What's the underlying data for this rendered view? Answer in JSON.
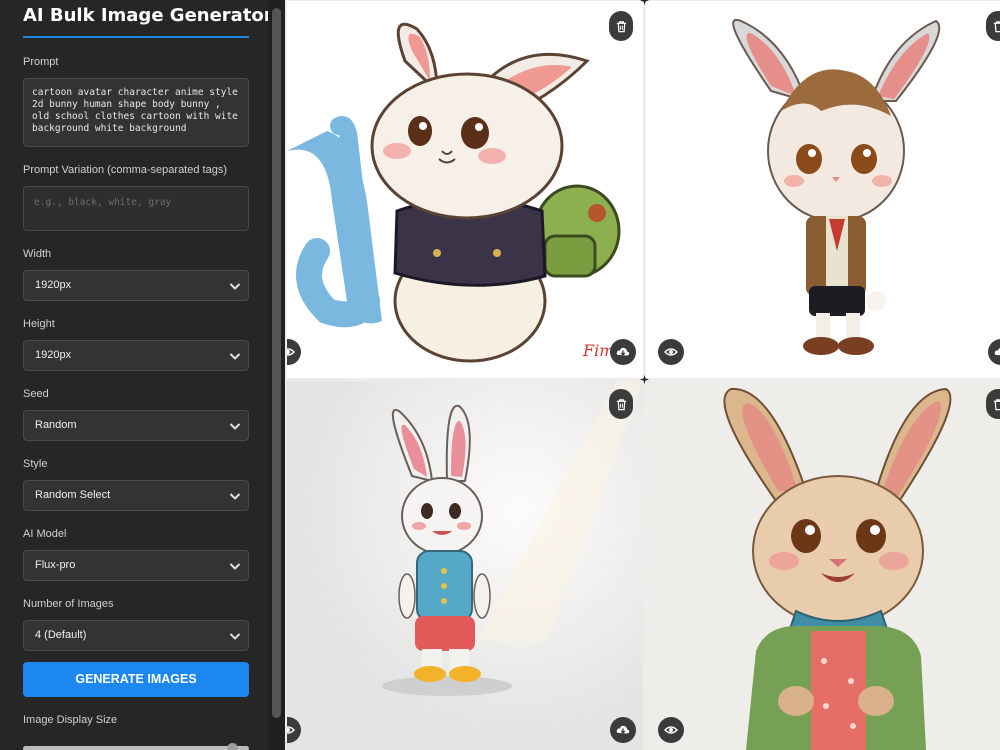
{
  "app": {
    "title": "AI Bulk Image Generator"
  },
  "form": {
    "prompt_label": "Prompt",
    "prompt_value": "cartoon avatar character anime style 2d bunny human shape body bunny , old school clothes cartoon with wite background white background",
    "variation_label": "Prompt Variation (comma-separated tags)",
    "variation_placeholder": "e.g., black, white, gray",
    "width_label": "Width",
    "width_value": "1920px",
    "height_label": "Height",
    "height_value": "1920px",
    "seed_label": "Seed",
    "seed_value": "Random",
    "style_label": "Style",
    "style_value": "Random Select",
    "model_label": "AI Model",
    "model_value": "Flux-pro",
    "count_label": "Number of Images",
    "count_value": "4 (Default)",
    "generate_label": "GENERATE IMAGES",
    "display_size_label": "Image Display Size",
    "display_size_level": 0.95
  },
  "gallery": {
    "images": [
      {
        "signature": "Fimc"
      },
      {
        "signature": ""
      },
      {
        "signature": ""
      },
      {
        "signature": ""
      }
    ]
  },
  "icons": {
    "delete": "trash-icon",
    "view": "eye-icon",
    "download": "cloud-download-icon",
    "dropdown": "chevron-down-icon"
  },
  "colors": {
    "sidebar_bg": "#262626",
    "accent": "#1b87ef",
    "input_bg": "#333333"
  }
}
